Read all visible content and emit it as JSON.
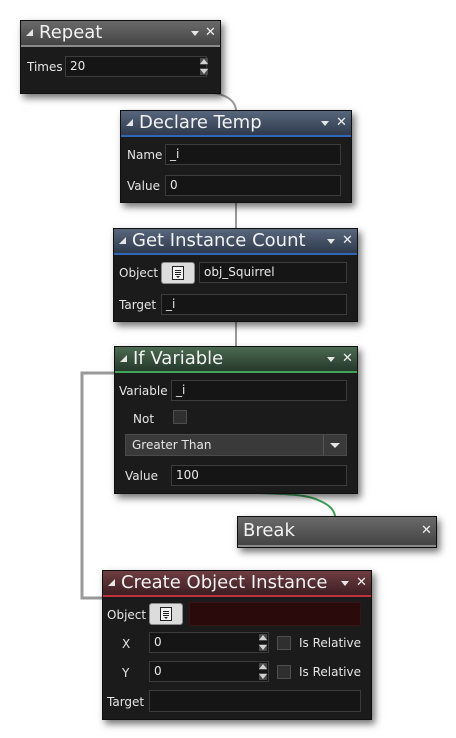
{
  "repeat": {
    "title": "Repeat",
    "times_label": "Times",
    "times_value": "20"
  },
  "declare_temp": {
    "title": "Declare Temp",
    "name_label": "Name",
    "name_value": "_i",
    "value_label": "Value",
    "value_value": "0"
  },
  "get_instance_count": {
    "title": "Get Instance Count",
    "object_label": "Object",
    "object_value": "obj_Squirrel",
    "target_label": "Target",
    "target_value": "_i"
  },
  "if_variable": {
    "title": "If Variable",
    "variable_label": "Variable",
    "variable_value": "_i",
    "not_label": "Not",
    "comparison": "Greater Than",
    "value_label": "Value",
    "value_value": "100"
  },
  "break": {
    "title": "Break"
  },
  "create_object_instance": {
    "title": "Create Object Instance",
    "object_label": "Object",
    "object_value": "",
    "x_label": "X",
    "x_value": "0",
    "x_relative_label": "Is Relative",
    "y_label": "Y",
    "y_value": "0",
    "y_relative_label": "Is Relative",
    "target_label": "Target",
    "target_value": ""
  },
  "colors": {
    "repeat": "#8c8c8c",
    "declare_temp": "#2f66b8",
    "if_variable": "#3fa35a",
    "create_object_instance": "#c0333c",
    "connector": "#9a9a9a"
  },
  "icons": {
    "collapse": "collapse-triangle-icon",
    "menu": "dropdown-arrow-icon",
    "close": "close-icon",
    "object_picker": "object-picker-icon"
  }
}
